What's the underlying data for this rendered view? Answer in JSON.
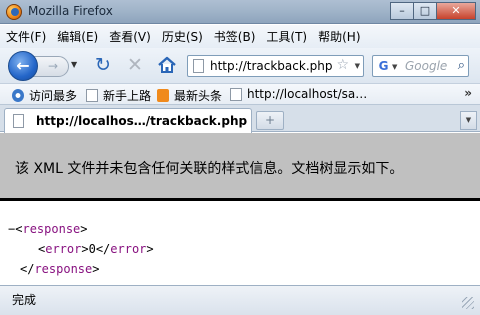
{
  "window": {
    "title": "Mozilla Firefox",
    "buttons": {
      "minimize": "–",
      "maximize": "□",
      "close": "✕"
    }
  },
  "menubar": {
    "items": [
      "文件(F)",
      "编辑(E)",
      "查看(V)",
      "历史(S)",
      "书签(B)",
      "工具(T)",
      "帮助(H)"
    ]
  },
  "navbar": {
    "back_label": "←",
    "forward_label": "→",
    "reload_label": "↻",
    "stop_label": "✕",
    "url": "http://trackback.php",
    "search_placeholder": "Google"
  },
  "bookmarks": {
    "items": [
      "访问最多",
      "新手上路",
      "最新头条",
      "http://localhost/sa…"
    ],
    "more_label": "»"
  },
  "tabs": {
    "active_label": "http://localhos…/trackback.php",
    "new_tab_label": "+"
  },
  "content": {
    "info_message": "该 XML 文件并未包含任何关联的样式信息。文档树显示如下。",
    "xml": {
      "collapse_marker": "−",
      "root_tag": "response",
      "child_tag": "error",
      "child_value": "0"
    }
  },
  "status": {
    "text": "完成"
  },
  "colors": {
    "xml_tag": "#881280",
    "info_background": "#c0c0c0",
    "accent": "#2466c9"
  }
}
